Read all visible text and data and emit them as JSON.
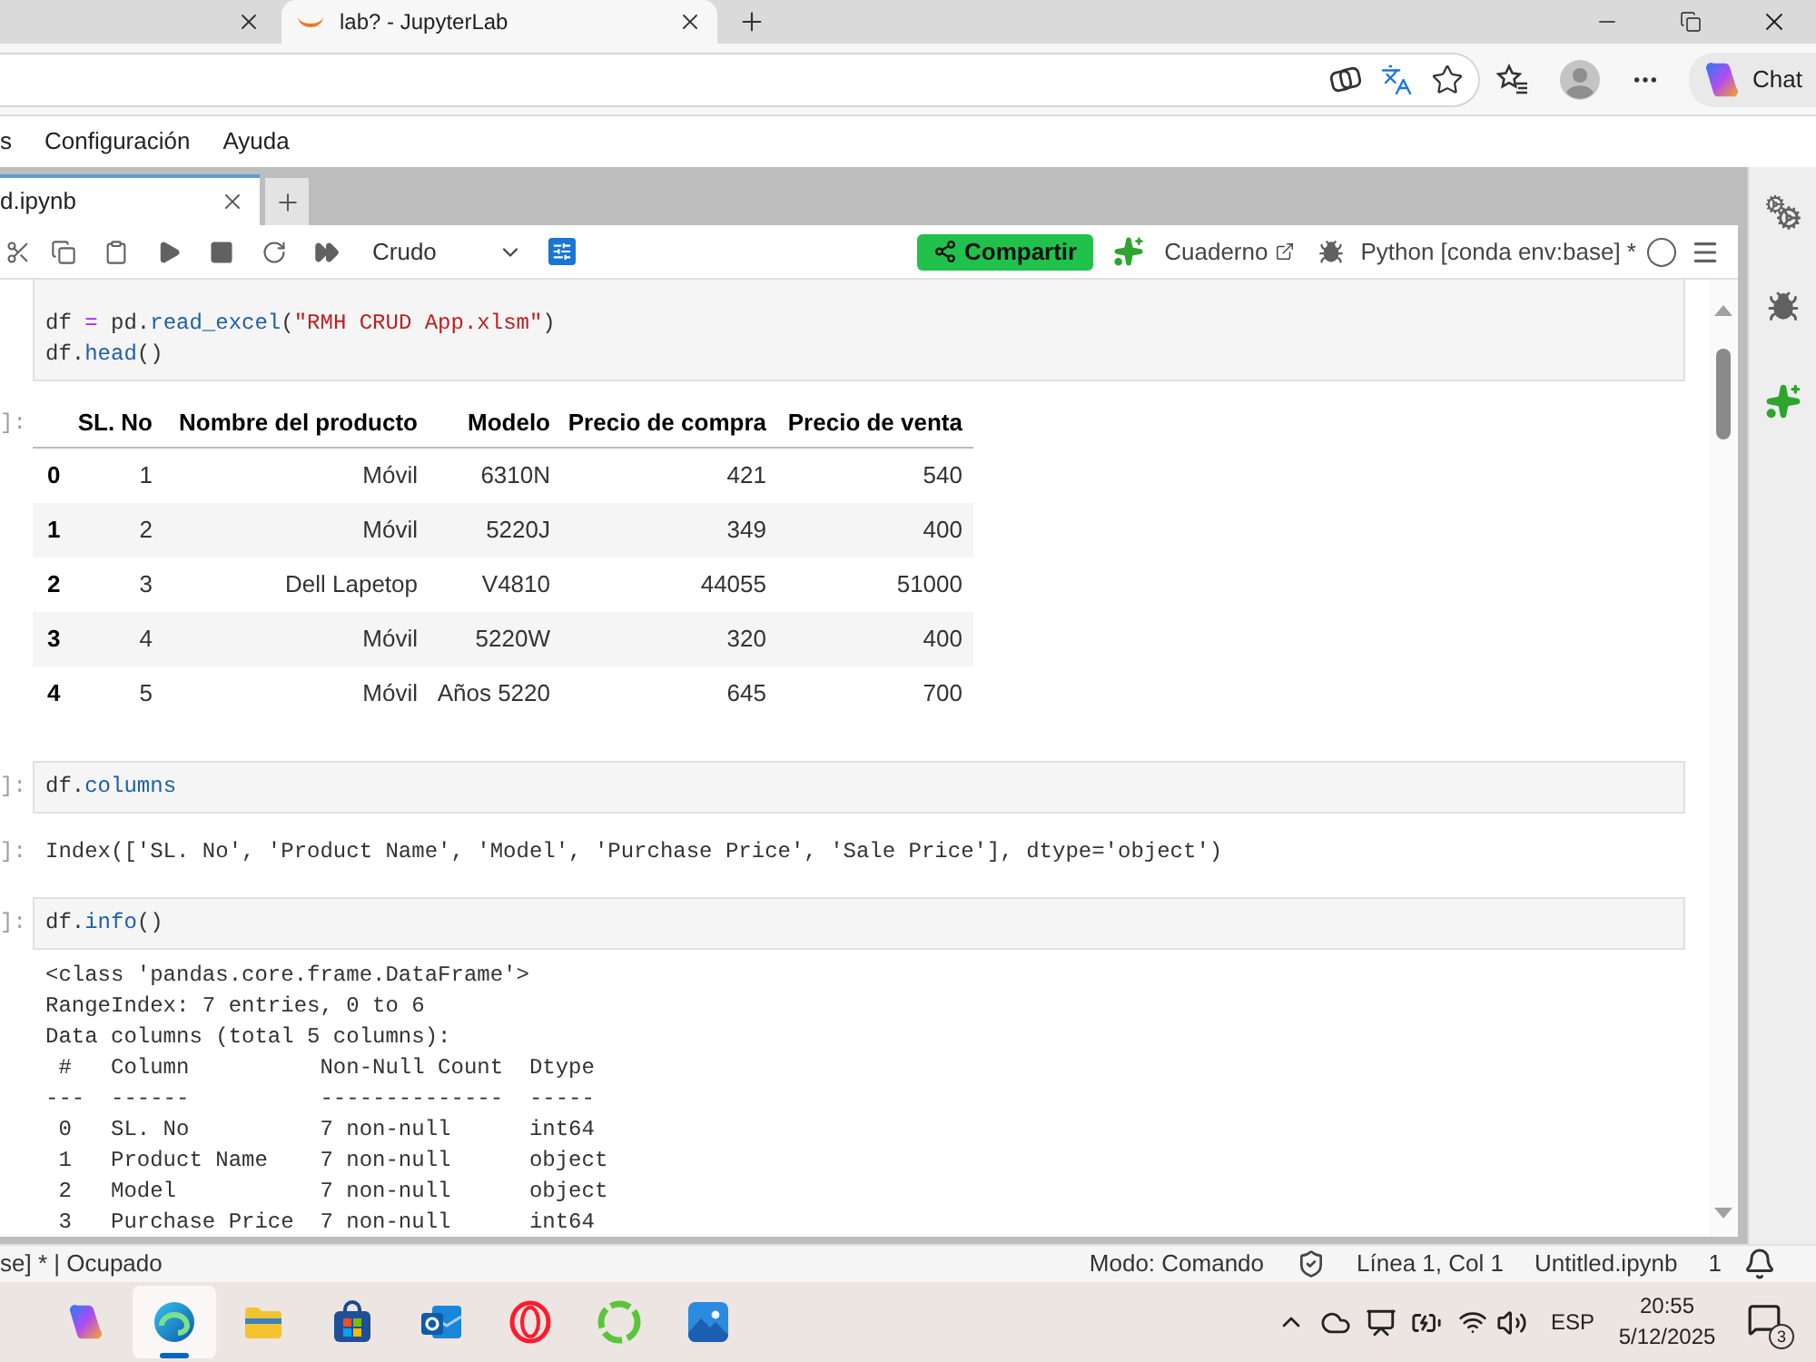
{
  "browser": {
    "tabs": [
      {
        "selected": false
      },
      {
        "title": "lab? - JupyterLab",
        "selected": true
      }
    ],
    "chat_button": "Chat"
  },
  "menu": [
    "s",
    "Configuración",
    "Ayuda"
  ],
  "notebook_tabs": [
    {
      "title": "d.ipynb",
      "selected": true
    }
  ],
  "toolbar": {
    "cell_type": "Crudo",
    "share_button": "Compartir",
    "notebook_link": "Cuaderno",
    "kernel": "Python [conda env:base] *"
  },
  "cells": [
    {
      "kind": "code",
      "lines": [
        [
          {
            "text": "df ",
            "kind": "name"
          },
          {
            "text": "=",
            "kind": "operator"
          },
          {
            "text": " pd.",
            "kind": "name"
          },
          {
            "text": "read_excel",
            "kind": "method"
          },
          {
            "text": "(",
            "kind": "name"
          },
          {
            "text": "\"RMH CRUD App.xlsm\"",
            "kind": "string"
          },
          {
            "text": ")",
            "kind": "name"
          }
        ],
        [
          {
            "text": "df.",
            "kind": "name"
          },
          {
            "text": "head",
            "kind": "method"
          },
          {
            "text": "()",
            "kind": "name"
          }
        ]
      ]
    },
    {
      "kind": "table",
      "prompt": "]:",
      "columns": [
        "SL. No",
        "Nombre del producto",
        "Modelo",
        "Precio de compra",
        "Precio de venta"
      ],
      "rows": [
        {
          "index": "0",
          "values": [
            "1",
            "Móvil",
            "6310N",
            "421",
            "540"
          ]
        },
        {
          "index": "1",
          "values": [
            "2",
            "Móvil",
            "5220J",
            "349",
            "400"
          ]
        },
        {
          "index": "2",
          "values": [
            "3",
            "Dell Lapetop",
            "V4810",
            "44055",
            "51000"
          ]
        },
        {
          "index": "3",
          "values": [
            "4",
            "Móvil",
            "5220W",
            "320",
            "400"
          ]
        },
        {
          "index": "4",
          "values": [
            "5",
            "Móvil",
            "Años 5220",
            "645",
            "700"
          ]
        }
      ]
    },
    {
      "kind": "code",
      "prompt": "]:",
      "lines": [
        [
          {
            "text": "df.",
            "kind": "name"
          },
          {
            "text": "columns",
            "kind": "method"
          }
        ]
      ]
    },
    {
      "kind": "text",
      "prompt": "]:",
      "lines": [
        "Index(['SL. No', 'Product Name', 'Model', 'Purchase Price', 'Sale Price'], dtype='object')"
      ]
    },
    {
      "kind": "code",
      "prompt": "]:",
      "lines": [
        [
          {
            "text": "df.",
            "kind": "name"
          },
          {
            "text": "info",
            "kind": "method"
          },
          {
            "text": "()",
            "kind": "name"
          }
        ]
      ]
    },
    {
      "kind": "text",
      "lines": [
        "<class 'pandas.core.frame.DataFrame'>",
        "RangeIndex: 7 entries, 0 to 6",
        "Data columns (total 5 columns):",
        " #   Column          Non-Null Count  Dtype",
        "---  ------          --------------  -----",
        " 0   SL. No          7 non-null      int64",
        " 1   Product Name    7 non-null      object",
        " 2   Model           7 non-null      object",
        " 3   Purchase Price  7 non-null      int64"
      ]
    }
  ],
  "status_bar": {
    "kernel": "se] * | Ocupado",
    "mode": "Modo: Comando",
    "cursor": "Línea 1, Col 1",
    "file": "Untitled.ipynb",
    "notifications": "1"
  },
  "taskbar": {
    "apps": [
      {
        "kind": "assistant",
        "selected": false
      },
      {
        "kind": "browser",
        "selected": true
      },
      {
        "kind": "folder",
        "selected": false
      },
      {
        "kind": "bag",
        "selected": false
      },
      {
        "kind": "mail",
        "selected": false
      },
      {
        "kind": "ring",
        "selected": false
      },
      {
        "kind": "spinner",
        "selected": false
      },
      {
        "kind": "picture",
        "selected": false
      }
    ],
    "language": "ESP",
    "time": "20:55",
    "date": "5/12/2025",
    "notification_count": "3"
  }
}
